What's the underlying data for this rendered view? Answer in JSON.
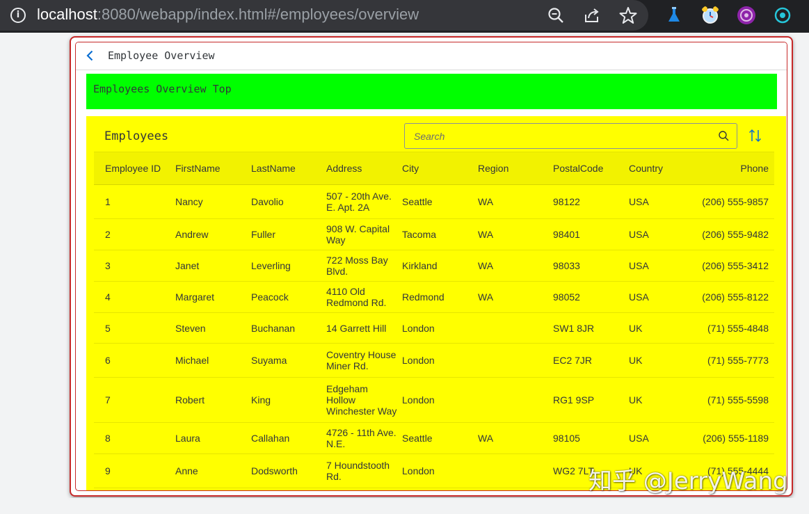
{
  "browser": {
    "url_host": "localhost",
    "url_rest": ":8080/webapp/index.html#/employees/overview",
    "icons": [
      "info-icon",
      "zoom-icon",
      "share-icon",
      "bookmark-star-icon",
      "extension-flask-icon",
      "extension-alarm-icon",
      "extension-purple-icon",
      "extension-teal-icon"
    ]
  },
  "page": {
    "title": "Employee Overview",
    "top_panel_text": "Employees Overview Top"
  },
  "table": {
    "title": "Employees",
    "search_placeholder": "Search",
    "columns": [
      "Employee ID",
      "FirstName",
      "LastName",
      "Address",
      "City",
      "Region",
      "PostalCode",
      "Country",
      "Phone"
    ],
    "rows": [
      {
        "id": "1",
        "first": "Nancy",
        "last": "Davolio",
        "address": "507 - 20th Ave. E. Apt. 2A",
        "city": "Seattle",
        "region": "WA",
        "postal": "98122",
        "country": "USA",
        "phone": "(206) 555-9857"
      },
      {
        "id": "2",
        "first": "Andrew",
        "last": "Fuller",
        "address": "908 W. Capital Way",
        "city": "Tacoma",
        "region": "WA",
        "postal": "98401",
        "country": "USA",
        "phone": "(206) 555-9482"
      },
      {
        "id": "3",
        "first": "Janet",
        "last": "Leverling",
        "address": "722 Moss Bay Blvd.",
        "city": "Kirkland",
        "region": "WA",
        "postal": "98033",
        "country": "USA",
        "phone": "(206) 555-3412"
      },
      {
        "id": "4",
        "first": "Margaret",
        "last": "Peacock",
        "address": "4110 Old Redmond Rd.",
        "city": "Redmond",
        "region": "WA",
        "postal": "98052",
        "country": "USA",
        "phone": "(206) 555-8122"
      },
      {
        "id": "5",
        "first": "Steven",
        "last": "Buchanan",
        "address": "14 Garrett Hill",
        "city": "London",
        "region": "",
        "postal": "SW1 8JR",
        "country": "UK",
        "phone": "(71) 555-4848"
      },
      {
        "id": "6",
        "first": "Michael",
        "last": "Suyama",
        "address": "Coventry House Miner Rd.",
        "city": "London",
        "region": "",
        "postal": "EC2 7JR",
        "country": "UK",
        "phone": "(71) 555-7773"
      },
      {
        "id": "7",
        "first": "Robert",
        "last": "King",
        "address": "Edgeham Hollow Winchester Way",
        "city": "London",
        "region": "",
        "postal": "RG1 9SP",
        "country": "UK",
        "phone": "(71) 555-5598"
      },
      {
        "id": "8",
        "first": "Laura",
        "last": "Callahan",
        "address": "4726 - 11th Ave. N.E.",
        "city": "Seattle",
        "region": "WA",
        "postal": "98105",
        "country": "USA",
        "phone": "(206) 555-1189"
      },
      {
        "id": "9",
        "first": "Anne",
        "last": "Dodsworth",
        "address": "7 Houndstooth Rd.",
        "city": "London",
        "region": "",
        "postal": "WG2 7LT",
        "country": "UK",
        "phone": "(71) 555-4444"
      }
    ]
  },
  "watermark": "知乎 @JerryWang",
  "colors": {
    "top_panel": "#00ff00",
    "table_panel": "#ffff00",
    "highlight_border": "#c62828",
    "link_blue": "#0a6ed1"
  }
}
